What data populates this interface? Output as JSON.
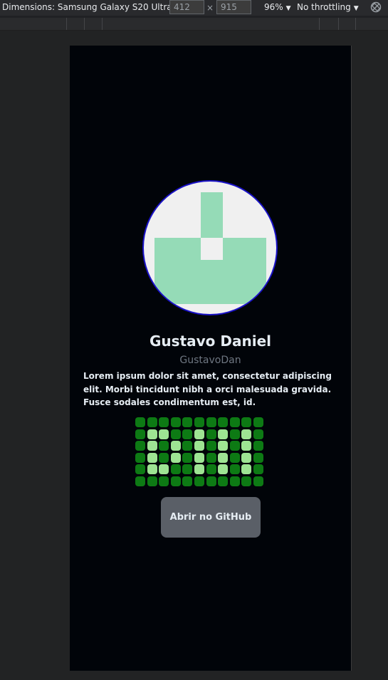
{
  "devtools": {
    "device_label": "Dimensions: Samsung Galaxy S20 Ultra",
    "width": "412",
    "height": "915",
    "times": "×",
    "zoom": "96%",
    "throttling": "No throttling",
    "dropdown_arrow": "▼"
  },
  "profile": {
    "name": "Gustavo Daniel",
    "username": "GustavoDan",
    "bio": "Lorem ipsum dolor sit amet, consectetur adipiscing elit. Morbi tincidunt nibh a orci malesuada gravida. Fusce sodales condimentum est, id.",
    "avatar_colors": {
      "background": "#f0f0f0",
      "pattern": "#95dbb7",
      "border": "#1a12c7"
    },
    "github_button_label": "Abrir no GitHub"
  },
  "dot_grid": {
    "on_color": "#9ee493",
    "off_color": "#0d7a14",
    "rows": [
      "00000000000",
      "01100101010",
      "01010101010",
      "01010101010",
      "01100101010",
      "00000000000"
    ]
  }
}
